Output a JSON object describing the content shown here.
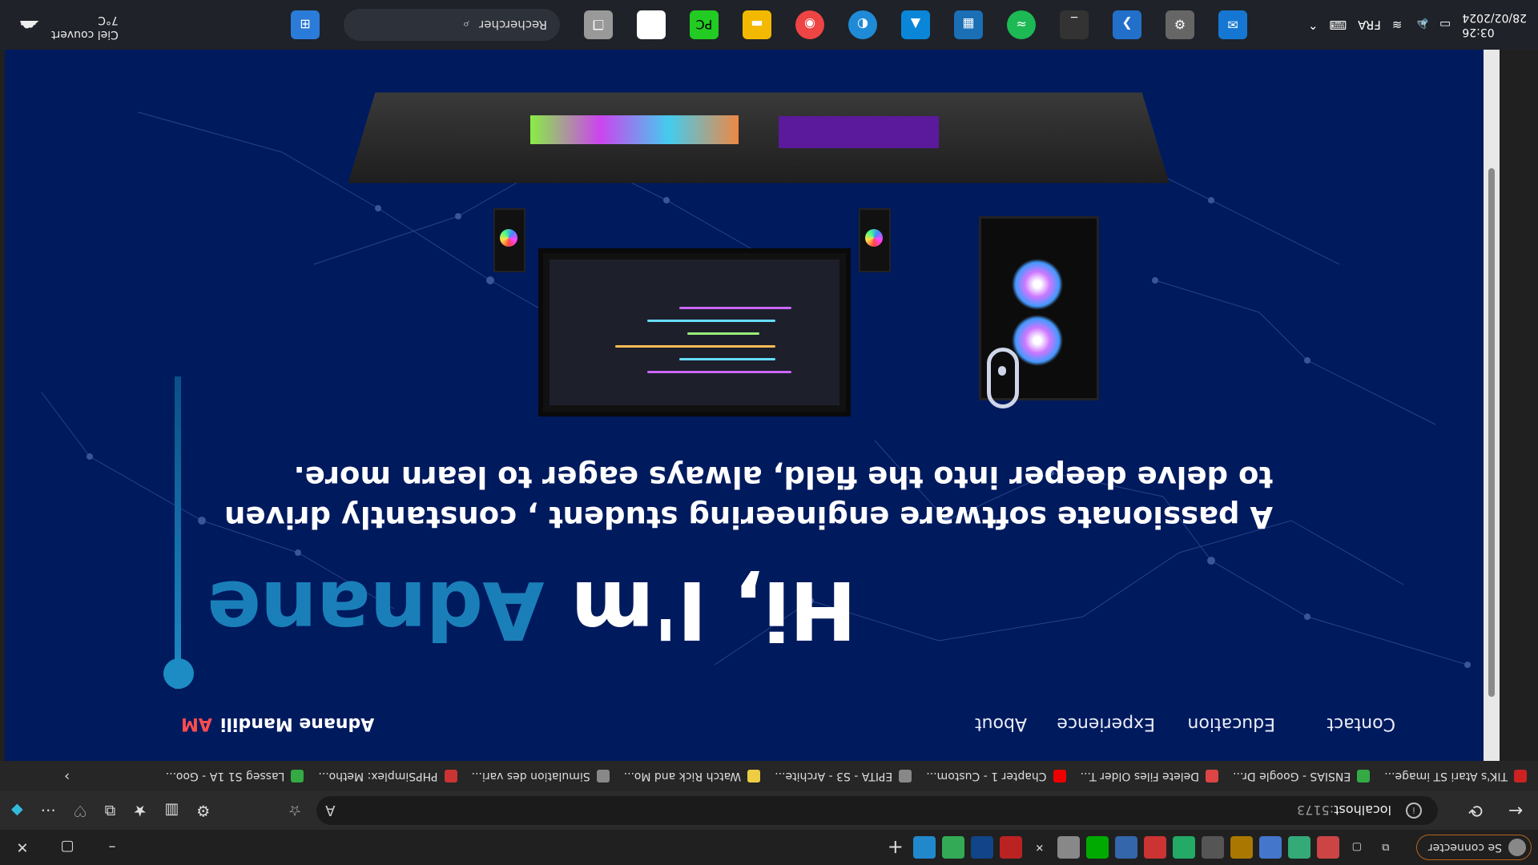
{
  "taskbar": {
    "time": "03:26",
    "date": "28/02/2024",
    "lang": "FRA",
    "search_placeholder": "Rechercher",
    "weather_temp": "7°C",
    "weather_desc": "Ciel couvert"
  },
  "browser": {
    "profile_label": "Se connecter",
    "url_host": "localhost",
    "url_port": ":5173",
    "favorites": [
      "TIK's Atari ST image...",
      "ENSIAS - Google Dr...",
      "Delete Files Older T...",
      "Chapter 1 - Custom...",
      "EPITA - S3 - Archite...",
      "Watch Rick and Mo...",
      "Simulation des vari...",
      "PHPSimplex: Metho...",
      "Lasseg S1 1A - Goo..."
    ]
  },
  "site": {
    "logo_initials": "AM",
    "logo_name": "Adnane Mandili",
    "nav": {
      "about": "About",
      "experience": "Experience",
      "education": "Education",
      "contact": "Contact"
    },
    "hero": {
      "greeting": "Hi, I'm ",
      "name": "Adnane",
      "subtitle": "A passionate software engineering student , constantly driven to delve deeper into the field, always eager to learn more."
    }
  },
  "colors": {
    "page_bg": "#001a5e",
    "accent": "#1a7fb8",
    "logo_accent": "#ff4d4d"
  }
}
